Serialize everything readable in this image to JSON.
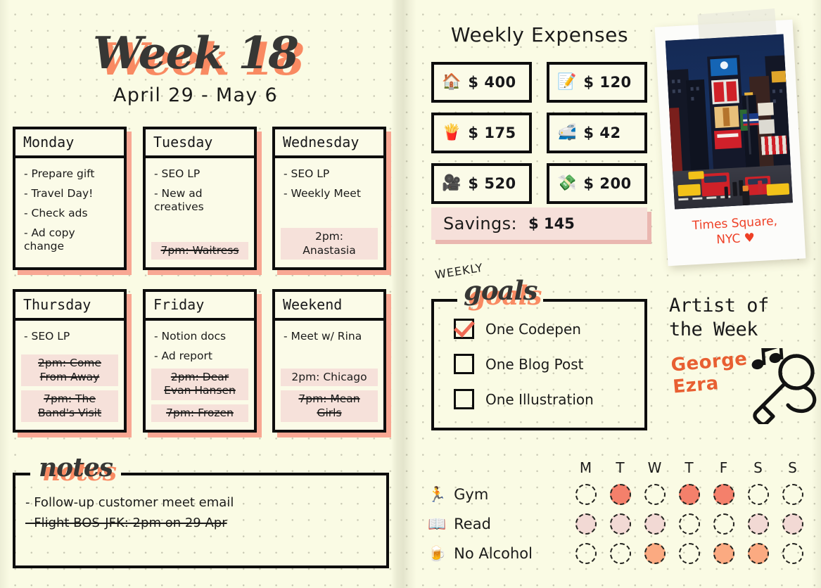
{
  "header": {
    "title": "Week 18",
    "dates": "April 29 - May 6"
  },
  "colors": {
    "paper": "#fafbe4",
    "ink": "#1b1b1a",
    "coral": "#f98a62",
    "coral_dark": "#ef6a54",
    "highlight_pink": "#f6e1da",
    "accent_red": "#ee4026",
    "accent_orange": "#e85f32",
    "gym_fill": "#f4806b",
    "read_fill": "#f2d9d4",
    "alcohol_fill": "#fbaa81"
  },
  "days": [
    {
      "name": "Monday",
      "tasks": [
        "- Prepare gift",
        "- Travel Day!",
        "- Check ads",
        "- Ad copy\nchange"
      ],
      "events": []
    },
    {
      "name": "Tuesday",
      "tasks": [
        "- SEO LP",
        "- New ad\ncreatives"
      ],
      "events": [
        {
          "text": "7pm: Waitress",
          "done": true
        }
      ]
    },
    {
      "name": "Wednesday",
      "tasks": [
        "- SEO LP",
        "- Weekly Meet"
      ],
      "events": [
        {
          "text": "2pm:\nAnastasia",
          "done": false
        }
      ]
    },
    {
      "name": "Thursday",
      "tasks": [
        "- SEO LP"
      ],
      "events": [
        {
          "text": "2pm: Come\nFrom Away",
          "done": true
        },
        {
          "text": "7pm: The\nBand's Visit",
          "done": true
        }
      ]
    },
    {
      "name": "Friday",
      "tasks": [
        "- Notion docs",
        "- Ad report"
      ],
      "events": [
        {
          "text": "2pm: Dear\nEvan Hansen",
          "done": true
        },
        {
          "text": "7pm: Frozen",
          "done": true
        }
      ]
    },
    {
      "name": "Weekend",
      "tasks": [
        "- Meet w/ Rina"
      ],
      "events": [
        {
          "text": "2pm: Chicago",
          "done": false
        },
        {
          "text": "7pm: Mean\nGirls",
          "done": true
        }
      ]
    }
  ],
  "notes": {
    "title": "notes",
    "lines": [
      {
        "text": "- Follow-up customer meet email",
        "done": false
      },
      {
        "text": "- Flight BOS-JFK: 2pm on 29 Apr",
        "done": true
      }
    ]
  },
  "expenses": {
    "title": "Weekly Expenses",
    "items": [
      {
        "icon": "house-icon",
        "glyph": "🏠",
        "amount": "$ 400"
      },
      {
        "icon": "memo-icon",
        "glyph": "📝",
        "amount": "$ 120"
      },
      {
        "icon": "fries-icon",
        "glyph": "🍟",
        "amount": "$ 175"
      },
      {
        "icon": "train-icon",
        "glyph": "🚅",
        "amount": "$ 42"
      },
      {
        "icon": "movie-camera-icon",
        "glyph": "🎥",
        "amount": "$ 520"
      },
      {
        "icon": "money-icon",
        "glyph": "💸",
        "amount": "$ 200"
      }
    ],
    "savings_label": "Savings:",
    "savings_amount": "$ 145"
  },
  "polaroid": {
    "caption_line1": "Times Square,",
    "caption_line2": "NYC ♥"
  },
  "goals": {
    "eyebrow": "WEEKLY",
    "title": "goals",
    "items": [
      {
        "label": "One Codepen",
        "checked": true
      },
      {
        "label": "One Blog Post",
        "checked": false
      },
      {
        "label": "One Illustration",
        "checked": false
      }
    ]
  },
  "artist": {
    "title_line1": "Artist of",
    "title_line2": "the Week",
    "name_line1": "George",
    "name_line2": "Ezra"
  },
  "tracker": {
    "day_labels": [
      "M",
      "T",
      "W",
      "T",
      "F",
      "S",
      "S"
    ],
    "habits": [
      {
        "icon": "runner-icon",
        "glyph": "🏃",
        "label": "Gym",
        "fill": "#f4806b",
        "marks": [
          false,
          true,
          false,
          true,
          true,
          false,
          false
        ]
      },
      {
        "icon": "open-book-icon",
        "glyph": "📖",
        "label": "Read",
        "fill": "#f2d9d4",
        "marks": [
          true,
          true,
          true,
          false,
          false,
          true,
          true
        ]
      },
      {
        "icon": "beer-icon",
        "glyph": "🍺",
        "label": "No Alcohol",
        "fill": "#fbaa81",
        "marks": [
          false,
          false,
          true,
          false,
          true,
          true,
          false
        ]
      }
    ]
  }
}
